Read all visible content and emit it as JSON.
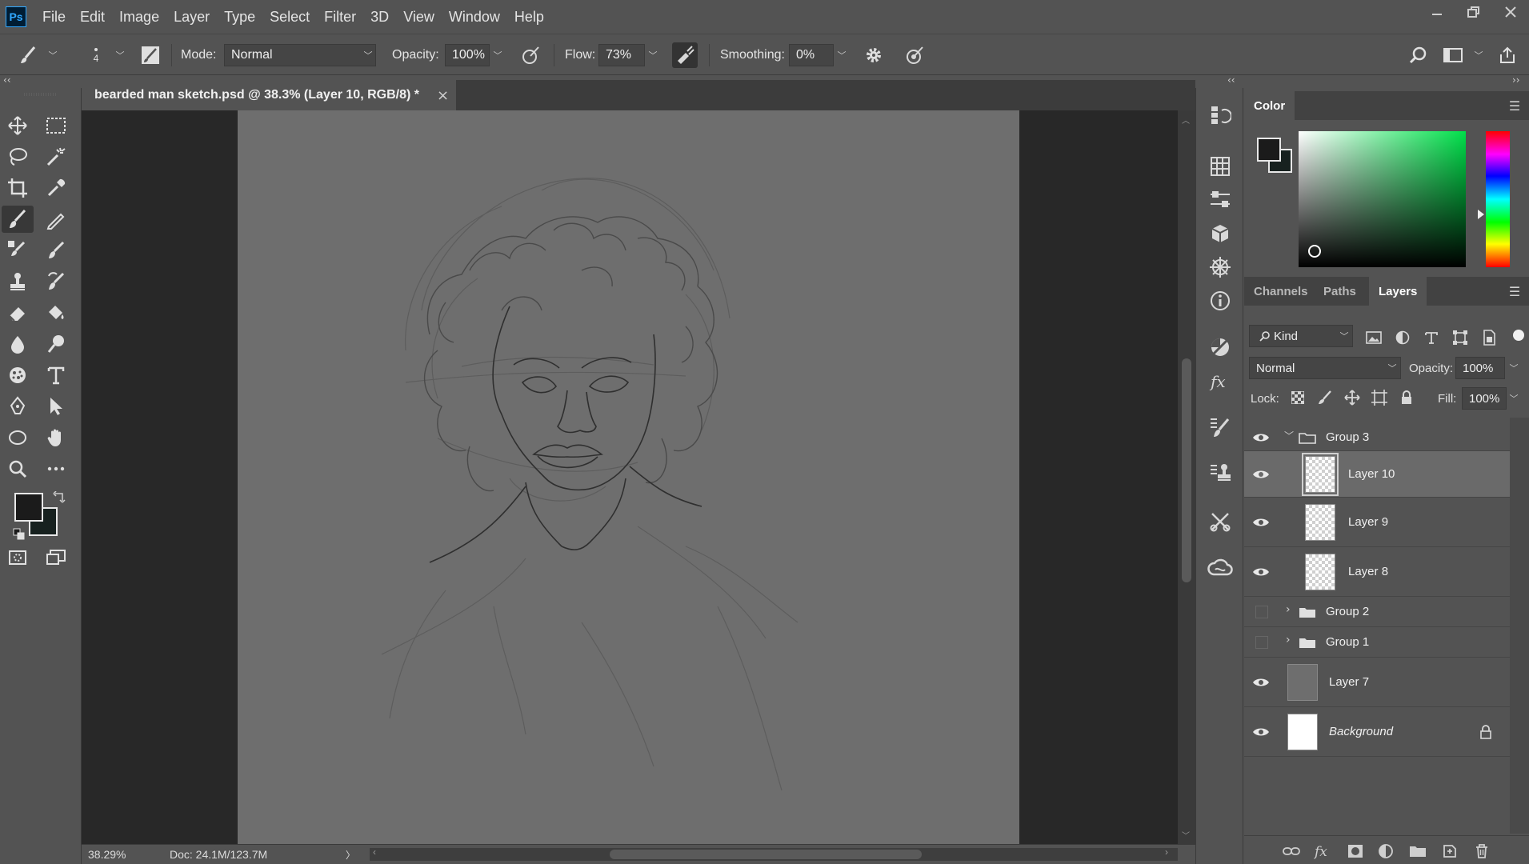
{
  "app": {
    "logo": "Ps"
  },
  "menu": [
    "File",
    "Edit",
    "Image",
    "Layer",
    "Type",
    "Select",
    "Filter",
    "3D",
    "View",
    "Window",
    "Help"
  ],
  "options": {
    "brush_size": "4",
    "mode_label": "Mode:",
    "mode_value": "Normal",
    "opacity_label": "Opacity:",
    "opacity_value": "100%",
    "flow_label": "Flow:",
    "flow_value": "73%",
    "smoothing_label": "Smoothing:",
    "smoothing_value": "0%"
  },
  "document": {
    "tab_title": "bearded man sketch.psd @ 38.3% (Layer 10, RGB/8) *",
    "close_glyph": "×"
  },
  "status": {
    "zoom": "38.29%",
    "doc_size": "Doc: 24.1M/123.7M",
    "arrow": "〉"
  },
  "color_panel": {
    "tab": "Color",
    "foreground": "#1b1b1b",
    "background": "#17211f",
    "hue_color": "#00e04a"
  },
  "layers_panel": {
    "tabs": [
      "Channels",
      "Paths",
      "Layers"
    ],
    "active_tab": "Layers",
    "kind_label": "Kind",
    "blend_mode": "Normal",
    "opacity_label": "Opacity:",
    "opacity_value": "100%",
    "lock_label": "Lock:",
    "fill_label": "Fill:",
    "fill_value": "100%",
    "layers": [
      {
        "name": "Group 3",
        "type": "group",
        "visible": true,
        "expanded": true
      },
      {
        "name": "Layer 10",
        "type": "layer",
        "visible": true,
        "selected": true
      },
      {
        "name": "Layer 9",
        "type": "layer",
        "visible": true
      },
      {
        "name": "Layer 8",
        "type": "layer",
        "visible": true
      },
      {
        "name": "Group 2",
        "type": "group",
        "visible": false,
        "expanded": false
      },
      {
        "name": "Group 1",
        "type": "group",
        "visible": false,
        "expanded": false
      },
      {
        "name": "Layer 7",
        "type": "layer",
        "visible": true
      },
      {
        "name": "Background",
        "type": "background",
        "visible": true,
        "locked": true
      }
    ]
  },
  "colors": {
    "ui_bg": "#535353",
    "canvas_bg": "#6e6e6e",
    "pasteboard": "#282828",
    "accent": "#31a8ff"
  }
}
